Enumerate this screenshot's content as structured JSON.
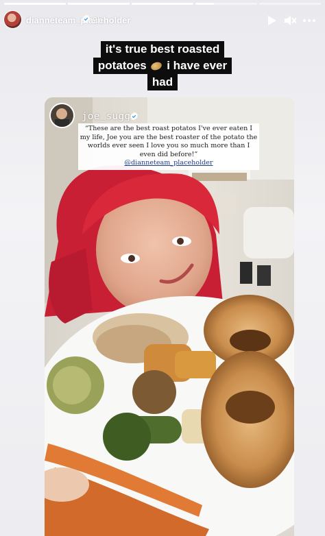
{
  "story": {
    "progress_segments": [
      1,
      1,
      1,
      0.3,
      0
    ],
    "user": {
      "username": "dianneteam_placeholder",
      "time_ago": "9h"
    },
    "caption_lines": [
      "it's true best roasted",
      "potatoes",
      "i have ever",
      "had"
    ]
  },
  "icons": {
    "play": "play-icon",
    "mute": "speaker-muted-icon",
    "more": "more-horizontal-icon",
    "verified": "verified-badge-icon",
    "potato": "potato-emoji"
  },
  "reshare": {
    "username": "joe_sugg",
    "quote_lines": [
      "“These are the best roast potatos I've ever eaten I",
      "my life, Joe you are the best roaster of the potato the",
      "worlds ever seen I love you so much more than I",
      "even did before!”"
    ],
    "mention": "@dianneteam_placeholder"
  },
  "colors": {
    "verified": "#3797f0",
    "caption_bg": "#0d0d0d",
    "hair": "#d8283a"
  }
}
